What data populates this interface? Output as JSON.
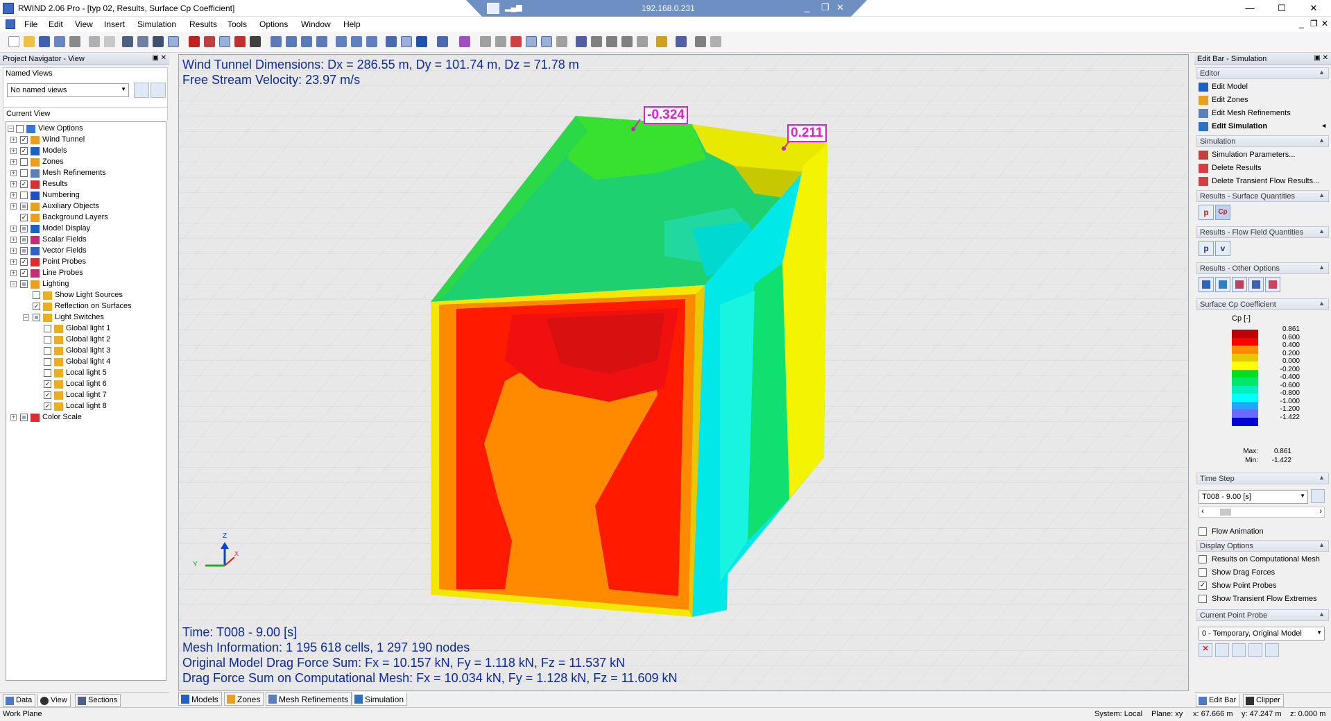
{
  "window": {
    "title": "RWIND 2.06 Pro - [typ 02, Results, Surface Cp Coefficient]",
    "remote_ip": "192.168.0.231",
    "minimize": "—",
    "maximize": "☐",
    "close": "✕",
    "mdi_minimize": "_",
    "mdi_restore": "❐",
    "mdi_close": "✕"
  },
  "menu": [
    "File",
    "Edit",
    "View",
    "Insert",
    "Simulation",
    "Results",
    "Tools",
    "Options",
    "Window",
    "Help"
  ],
  "left_panel": {
    "title": "Project Navigator - View",
    "named_views_label": "Named Views",
    "named_views_value": "No named views",
    "current_view_label": "Current View",
    "tree": [
      {
        "label": "View Options",
        "level": 0,
        "exp": "−",
        "checked": "none",
        "icon": "#3b78d4"
      },
      {
        "label": "Wind Tunnel",
        "level": 1,
        "exp": "+",
        "checked": "yes",
        "icon": "#e8a020"
      },
      {
        "label": "Models",
        "level": 1,
        "exp": "+",
        "checked": "yes",
        "icon": "#1f5fc2"
      },
      {
        "label": "Zones",
        "level": 1,
        "exp": "+",
        "checked": "no",
        "icon": "#e8a020"
      },
      {
        "label": "Mesh Refinements",
        "level": 1,
        "exp": "+",
        "checked": "no",
        "icon": "#5b7fb8"
      },
      {
        "label": "Results",
        "level": 1,
        "exp": "+",
        "checked": "yes",
        "icon": "#d83030"
      },
      {
        "label": "Numbering",
        "level": 1,
        "exp": "+",
        "checked": "no",
        "icon": "#2050c0"
      },
      {
        "label": "Auxiliary Objects",
        "level": 1,
        "exp": "+",
        "checked": "part",
        "icon": "#e8a020"
      },
      {
        "label": "Background Layers",
        "level": 1,
        "exp": "",
        "checked": "yes",
        "icon": "#e8a020"
      },
      {
        "label": "Model Display",
        "level": 1,
        "exp": "+",
        "checked": "part",
        "icon": "#1f5fc2"
      },
      {
        "label": "Scalar Fields",
        "level": 1,
        "exp": "+",
        "checked": "part",
        "icon": "#c03070"
      },
      {
        "label": "Vector Fields",
        "level": 1,
        "exp": "+",
        "checked": "part",
        "icon": "#3060c0"
      },
      {
        "label": "Point Probes",
        "level": 1,
        "exp": "+",
        "checked": "yes",
        "icon": "#d83030"
      },
      {
        "label": "Line Probes",
        "level": 1,
        "exp": "+",
        "checked": "yes",
        "icon": "#c03070"
      },
      {
        "label": "Lighting",
        "level": 1,
        "exp": "−",
        "checked": "part",
        "icon": "#e8a020"
      },
      {
        "label": "Show Light Sources",
        "level": 2,
        "exp": "",
        "checked": "no",
        "icon": "#e8b020"
      },
      {
        "label": "Reflection on Surfaces",
        "level": 2,
        "exp": "",
        "checked": "yes",
        "icon": "#e8b020"
      },
      {
        "label": "Light Switches",
        "level": 2,
        "exp": "−",
        "checked": "part",
        "icon": "#e8b020"
      },
      {
        "label": "Global light 1",
        "level": 3,
        "exp": "",
        "checked": "no",
        "icon": "#e8b020"
      },
      {
        "label": "Global light 2",
        "level": 3,
        "exp": "",
        "checked": "no",
        "icon": "#e8b020"
      },
      {
        "label": "Global light 3",
        "level": 3,
        "exp": "",
        "checked": "no",
        "icon": "#e8b020"
      },
      {
        "label": "Global light 4",
        "level": 3,
        "exp": "",
        "checked": "no",
        "icon": "#e8b020"
      },
      {
        "label": "Local light 5",
        "level": 3,
        "exp": "",
        "checked": "no",
        "icon": "#e8b020"
      },
      {
        "label": "Local light 6",
        "level": 3,
        "exp": "",
        "checked": "yes",
        "icon": "#e8b020"
      },
      {
        "label": "Local light 7",
        "level": 3,
        "exp": "",
        "checked": "yes",
        "icon": "#e8b020"
      },
      {
        "label": "Local light 8",
        "level": 3,
        "exp": "",
        "checked": "yes",
        "icon": "#e8b020"
      },
      {
        "label": "Color Scale",
        "level": 1,
        "exp": "+",
        "checked": "part",
        "icon": "#d83030"
      }
    ],
    "bottom_tabs": [
      "Data",
      "View",
      "Sections"
    ]
  },
  "viewport": {
    "top_lines": [
      "Wind Tunnel Dimensions: Dx = 286.55 m, Dy = 101.74 m, Dz = 71.78 m",
      "Free Stream Velocity: 23.97 m/s"
    ],
    "bottom_lines": [
      "Time: T008 - 9.00 [s]",
      "Mesh Information: 1 195 618 cells, 1 297 190 nodes",
      "Original Model Drag Force Sum: Fx = 10.157 kN, Fy = 1.118 kN, Fz = 11.537 kN",
      "Drag Force Sum on Computational Mesh: Fx = 10.034 kN, Fy = 1.128 kN, Fz = 11.609 kN"
    ],
    "probe_labels": [
      "-0.324",
      "0.211"
    ],
    "axis_labels": {
      "z": "Z",
      "y": "Y",
      "x": "X"
    },
    "tabs": [
      "Models",
      "Zones",
      "Mesh Refinements",
      "Simulation"
    ]
  },
  "right_panel": {
    "title": "Edit Bar - Simulation",
    "editor_label": "Editor",
    "editor_items": [
      "Edit Model",
      "Edit Zones",
      "Edit Mesh Refinements",
      "Edit Simulation"
    ],
    "simulation_label": "Simulation",
    "simulation_items": [
      "Simulation Parameters...",
      "Delete Results",
      "Delete Transient Flow Results..."
    ],
    "surface_quantities_label": "Results - Surface Quantities",
    "surface_buttons": [
      "p",
      "Cp"
    ],
    "flow_field_label": "Results - Flow Field Quantities",
    "flow_buttons": [
      "p",
      "v"
    ],
    "other_options_label": "Results - Other Options",
    "cp_label": "Surface Cp Coefficient",
    "legend_title": "Cp [-]",
    "legend": [
      {
        "value": "0.861",
        "color": "#c00000"
      },
      {
        "value": "0.600",
        "color": "#ff0000"
      },
      {
        "value": "0.400",
        "color": "#ff8c00"
      },
      {
        "value": "0.200",
        "color": "#e8c800"
      },
      {
        "value": "0.000",
        "color": "#ffff00"
      },
      {
        "value": "-0.200",
        "color": "#00e020"
      },
      {
        "value": "-0.400",
        "color": "#00e86c"
      },
      {
        "value": "-0.600",
        "color": "#00f0c0"
      },
      {
        "value": "-0.800",
        "color": "#00ffff"
      },
      {
        "value": "-1.000",
        "color": "#20a8ff"
      },
      {
        "value": "-1.200",
        "color": "#6a6aff"
      },
      {
        "value": "-1.422",
        "color": "#0000d8"
      }
    ],
    "max_label": "Max:",
    "max_value": "0.861",
    "min_label": "Min:",
    "min_value": "-1.422",
    "time_step_label": "Time Step",
    "time_step_value": "T008 - 9.00 [s]",
    "flow_animation": "Flow Animation",
    "display_options_label": "Display Options",
    "display_options": [
      {
        "label": "Results on Computational Mesh",
        "checked": false
      },
      {
        "label": "Show Drag Forces",
        "checked": false
      },
      {
        "label": "Show Point Probes",
        "checked": true
      },
      {
        "label": "Show Transient Flow Extremes",
        "checked": false
      }
    ],
    "point_probe_label": "Current Point Probe",
    "point_probe_value": "0 - Temporary, Original Model",
    "bottom_tabs": [
      "Edit Bar",
      "Clipper"
    ]
  },
  "status": {
    "left": "Work Plane",
    "system": "System: Local",
    "plane": "Plane: xy",
    "x": "x: 67.666 m",
    "y": "y: 47.247 m",
    "z": "z: 0.000 m"
  }
}
